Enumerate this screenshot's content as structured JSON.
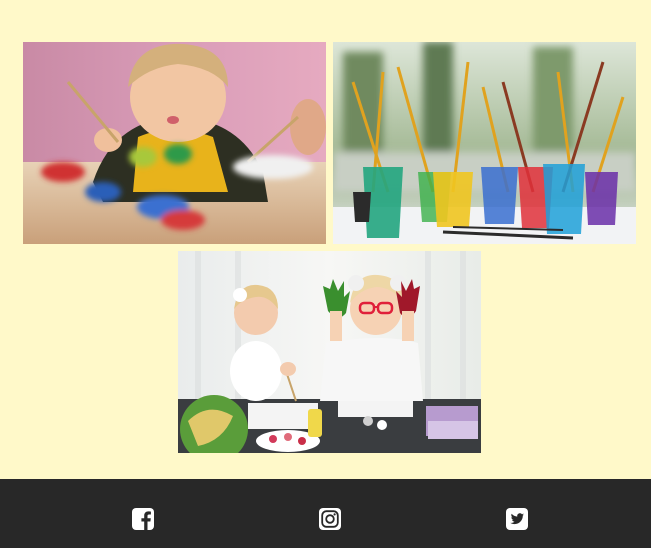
{
  "theme": {
    "background": "#fff9c9",
    "footer_background": "#282828",
    "icon_color": "#ffffff"
  },
  "gallery": {
    "images": [
      {
        "name": "boy-painting-photo"
      },
      {
        "name": "paint-cups-brushes-photo"
      },
      {
        "name": "girls-painted-hands-photo"
      }
    ]
  },
  "footer": {
    "social_links": [
      {
        "icon": "facebook-icon"
      },
      {
        "icon": "instagram-icon"
      },
      {
        "icon": "twitter-icon"
      }
    ]
  }
}
